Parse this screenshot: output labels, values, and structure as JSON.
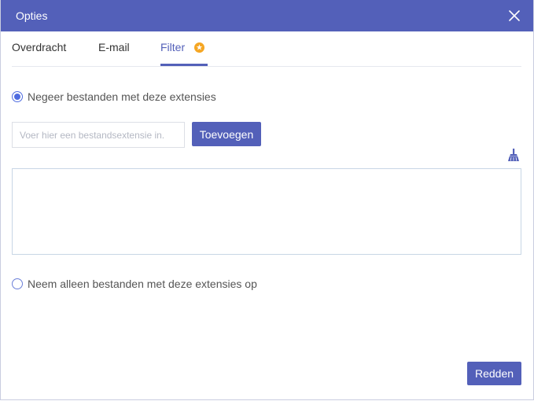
{
  "dialog": {
    "title": "Opties",
    "close_icon": "close-icon"
  },
  "tabs": [
    {
      "label": "Overdracht",
      "active": false
    },
    {
      "label": "E-mail",
      "active": false
    },
    {
      "label": "Filter",
      "active": true,
      "badge_icon": "star-badge-icon"
    }
  ],
  "filter": {
    "option_ignore": {
      "label": "Negeer bestanden met deze extensies",
      "selected": true
    },
    "extension_input": {
      "value": "",
      "placeholder": "Voer hier een bestandsextensie in."
    },
    "add_label": "Toevoegen",
    "clear_icon": "broom-icon",
    "extension_list": [],
    "option_include": {
      "label": "Neem alleen bestanden met deze extensies op",
      "selected": false
    }
  },
  "footer": {
    "save_label": "Redden"
  },
  "colors": {
    "accent": "#5360b9",
    "badge": "#f5a623",
    "radio_dot": "#4f6ce0"
  }
}
